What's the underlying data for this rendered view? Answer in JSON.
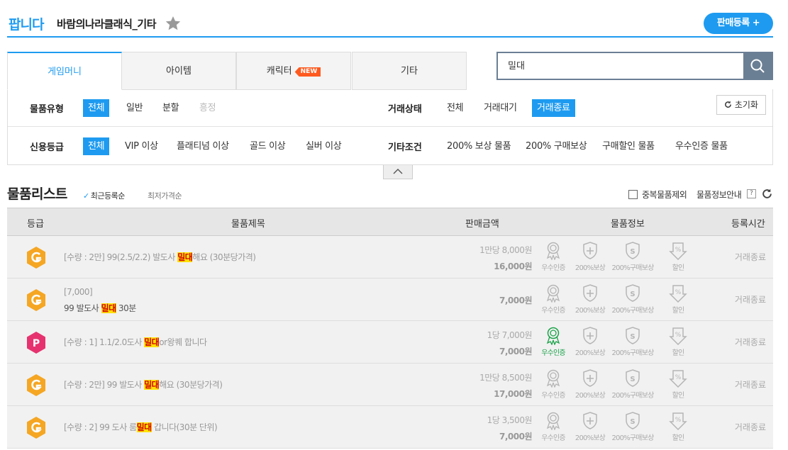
{
  "header": {
    "brand": "팝니다",
    "game_title": "바람의나라클래식_기타",
    "sell_button": "판매등록 +"
  },
  "tabs": [
    {
      "label": "게임머니",
      "active": true
    },
    {
      "label": "아이템",
      "active": false
    },
    {
      "label": "캐릭터",
      "active": false,
      "badge": "NEW"
    },
    {
      "label": "기타",
      "active": false
    }
  ],
  "search": {
    "value": "밀대"
  },
  "filters": {
    "item_type": {
      "label": "물품유형",
      "options": [
        "전체",
        "일반",
        "분할",
        "흥정"
      ],
      "selected": "전체",
      "disabled": [
        "흥정"
      ]
    },
    "trade_status": {
      "label": "거래상태",
      "options": [
        "전체",
        "거래대기",
        "거래종료"
      ],
      "selected": "거래종료"
    },
    "credit_grade": {
      "label": "신용등급",
      "options": [
        "전체",
        "VIP 이상",
        "플래티넘 이상",
        "골드 이상",
        "실버 이상"
      ],
      "selected": "전체"
    },
    "etc_cond": {
      "label": "기타조건",
      "options": [
        "200% 보상 물품",
        "200% 구매보상",
        "구매할인 물품",
        "우수인증 물품"
      ]
    },
    "reset": "초기화"
  },
  "list": {
    "title": "물품리스트",
    "sort_recent": "최근등록순",
    "sort_price": "최저가격순",
    "dup_exclude": "중복물품제외",
    "info_guide": "물품정보안내",
    "help": "?"
  },
  "columns": [
    "등급",
    "물품제목",
    "판매금액",
    "물품정보",
    "등록시간"
  ],
  "badge_labels": [
    "우수인증",
    "200%보상",
    "200%구매보상",
    "할인"
  ],
  "colors": {
    "accent": "#1e9bf0",
    "grade_orange": "#f5a623",
    "grade_pink": "#e6336f",
    "certified_green": "#1ca34a",
    "highlight": "#ffe100"
  },
  "rows": [
    {
      "grade": "G",
      "line1_pre": "[수량 : 2만] 99(2.5/2.2) 발도사 ",
      "hl": "밀대",
      "line1_post": "해요 (30분당가격)",
      "unit": "1만당 8,000원",
      "total": "16,000원",
      "status": "거래종료"
    },
    {
      "grade": "G",
      "line1_pre": "[7,000]",
      "line2_pre": "99 발도사 ",
      "hl": "밀대",
      "line2_post": " 30분",
      "total": "7,000원",
      "status": "거래종료"
    },
    {
      "grade": "P",
      "line1_pre": "[수량 : 1] 1.1/2.0도사 ",
      "hl": "밀대",
      "line1_post": "or왕퀘 합니다",
      "unit": "1당 7,000원",
      "total": "7,000원",
      "status": "거래종료",
      "certified": true
    },
    {
      "grade": "G",
      "line1_pre": "[수량 : 2만] 99 발도사 ",
      "hl": "밀대",
      "line1_post": "해요 (30분당가격)",
      "unit": "1만당 8,500원",
      "total": "17,000원",
      "status": "거래종료"
    },
    {
      "grade": "G",
      "line1_pre": "[수량 : 2] 99 도사 룸",
      "hl": "밀대",
      "line1_post": " 갑니다(30분 단위)",
      "unit": "1당 3,500원",
      "total": "7,000원",
      "status": "거래종료"
    }
  ]
}
